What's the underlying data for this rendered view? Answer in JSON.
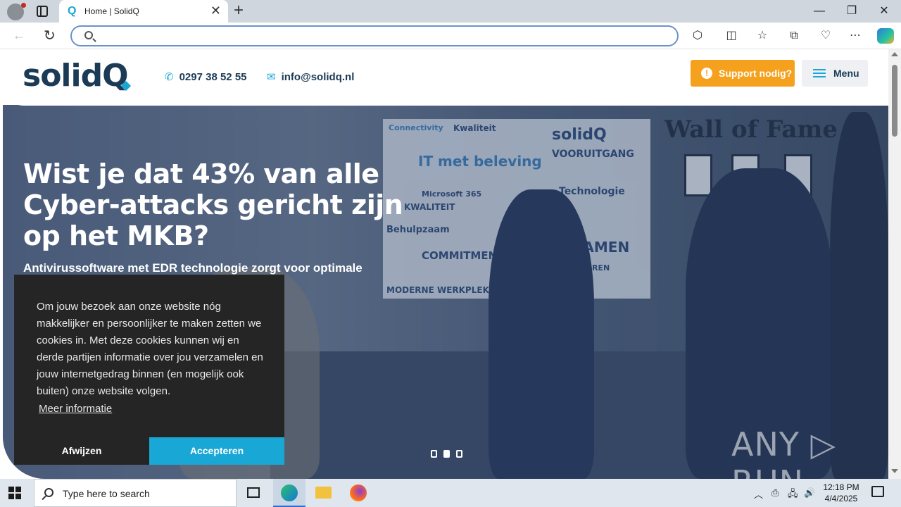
{
  "browser": {
    "tab_title": "Home | SolidQ",
    "tab_favicon": "Q",
    "address_placeholder": "",
    "new_tab": "+",
    "close_tab": "✕"
  },
  "header": {
    "logo_text": "solid",
    "logo_q": "Q",
    "phone": "0297 38 52 55",
    "email": "info@solidq.nl",
    "support_label": "Support nodig?",
    "menu_label": "Menu"
  },
  "hero": {
    "title": "Wist je dat 43% van alle Cyber-attacks gericht zijn op het MKB?",
    "subtitle": "Antivirussoftware met EDR technologie zorgt voor optimale",
    "wall_of_fame": "Wall of Fame",
    "wall_words": [
      "Connectivity",
      "Kwaliteit",
      "solidQ",
      "IT met beleving",
      "VOORUITGANG",
      "Technologie",
      "Microsoft 365",
      "KWALITEIT",
      "SAMEN",
      "COMMITMENT",
      "PRESTEREN",
      "Behulpzaam",
      "MODERNE WERKPLEK"
    ],
    "slide_count": 3,
    "active_slide": 2
  },
  "cookie": {
    "text": "Om jouw bezoek aan onze website nóg makkelijker en persoonlijker te maken zetten we cookies in. Met deze cookies kunnen wij en derde partijen informatie over jou verzamelen en jouw internetgedrag binnen (en mogelijk ook buiten) onze website volgen.",
    "more_info": "Meer informatie",
    "deny": "Afwijzen",
    "accept": "Accepteren"
  },
  "watermark": "ANY ▷ RUN",
  "taskbar": {
    "search_placeholder": "Type here to search",
    "time": "12:18 PM",
    "date": "4/4/2025"
  },
  "colors": {
    "brand_blue": "#19a7d6",
    "brand_dark": "#1b3a56",
    "support_orange": "#f5a11d"
  }
}
